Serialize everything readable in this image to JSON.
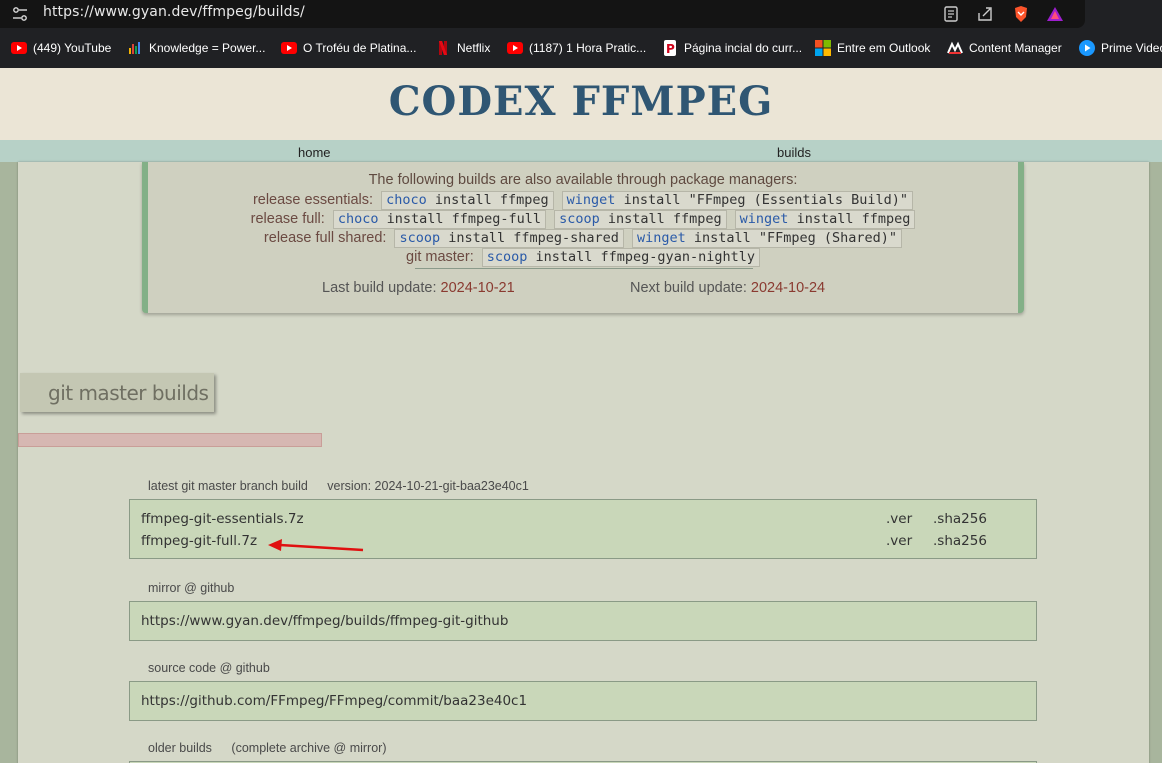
{
  "browser": {
    "url": "https://www.gyan.dev/ffmpeg/builds/",
    "bookmarks": [
      {
        "label": "(449) YouTube",
        "icon": "youtube-icon"
      },
      {
        "label": "Knowledge = Power...",
        "icon": "chart-icon"
      },
      {
        "label": "O Troféu de Platina...",
        "icon": "youtube-icon"
      },
      {
        "label": "Netflix",
        "icon": "netflix-icon"
      },
      {
        "label": "(1187) 1 Hora Pratic...",
        "icon": "youtube-icon"
      },
      {
        "label": "Página incial do curr...",
        "icon": "p-icon"
      },
      {
        "label": "Entre em Outlook",
        "icon": "microsoft-icon"
      },
      {
        "label": "Content Manager",
        "icon": "content-manager-icon"
      },
      {
        "label": "Prime Video",
        "icon": "prime-video-icon"
      }
    ]
  },
  "site": {
    "title": "CODEX FFMPEG",
    "nav": {
      "home": "home",
      "builds": "builds"
    }
  },
  "packages": {
    "intro": "The following builds are also available through package managers:",
    "release_essentials": {
      "label": "release essentials:",
      "cmds": [
        {
          "mgr": "choco",
          "rest": " install ffmpeg"
        },
        {
          "mgr": "winget",
          "rest": " install \"FFmpeg (Essentials Build)\""
        }
      ]
    },
    "release_full": {
      "label": "release full:",
      "cmds": [
        {
          "mgr": "choco",
          "rest": " install ffmpeg-full"
        },
        {
          "mgr": "scoop",
          "rest": " install ffmpeg"
        },
        {
          "mgr": "winget",
          "rest": " install ffmpeg"
        }
      ]
    },
    "release_full_shared": {
      "label": "release full shared:",
      "cmds": [
        {
          "mgr": "scoop",
          "rest": " install ffmpeg-shared"
        },
        {
          "mgr": "winget",
          "rest": " install \"FFmpeg (Shared)\""
        }
      ]
    },
    "git_master": {
      "label": "git master:",
      "cmds": [
        {
          "mgr": "scoop",
          "rest": " install ffmpeg-gyan-nightly"
        }
      ]
    },
    "last_update_label": "Last build update:",
    "last_update": "2024-10-21",
    "next_update_label": "Next build update:",
    "next_update": "2024-10-24"
  },
  "git_master": {
    "section_title": "git master builds",
    "latest_label": "latest git master branch build",
    "version": "version: 2024-10-21-git-baa23e40c1",
    "files": [
      {
        "name": "ffmpeg-git-essentials.7z",
        "ver": ".ver",
        "sha": ".sha256"
      },
      {
        "name": "ffmpeg-git-full.7z",
        "ver": ".ver",
        "sha": ".sha256"
      }
    ],
    "mirror_label": "mirror @ github",
    "mirror_url": "https://www.gyan.dev/ffmpeg/builds/ffmpeg-git-github",
    "source_label": "source code @ github",
    "source_url": "https://github.com/FFmpeg/FFmpeg/commit/baa23e40c1",
    "older_label": "older builds",
    "older_extra": "(complete archive @ mirror)"
  },
  "colors": {
    "title": "#2f5673",
    "date": "#8a3a30",
    "annotation_arrow": "#e01010"
  }
}
